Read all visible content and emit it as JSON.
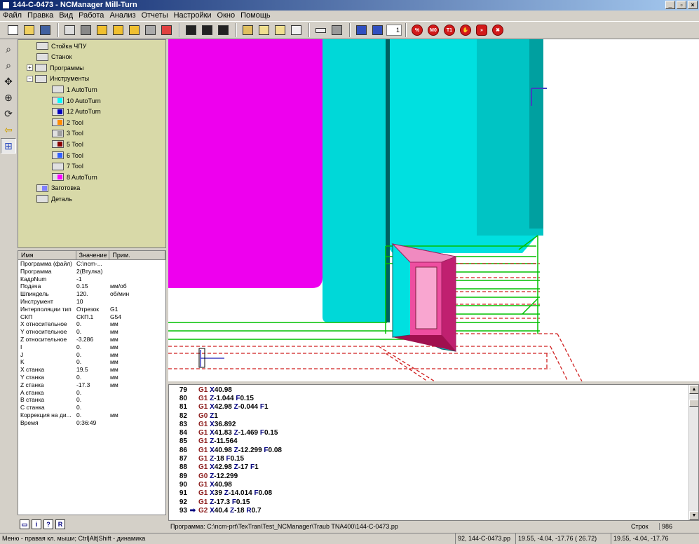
{
  "window": {
    "title": "144-C-0473 - NCManager Mill-Turn"
  },
  "menu": [
    "Файл",
    "Правка",
    "Вид",
    "Работа",
    "Анализ",
    "Отчеты",
    "Настройки",
    "Окно",
    "Помощь"
  ],
  "toolbar": {
    "spin_value": "1",
    "stop_labels": [
      "%",
      "M0",
      "T1",
      "",
      "»",
      ""
    ]
  },
  "tree": {
    "items": [
      {
        "label": "Стойка ЧПУ",
        "indent": 0,
        "swatch": ""
      },
      {
        "label": "Станок",
        "indent": 0,
        "swatch": ""
      },
      {
        "label": "Программы",
        "indent": 0,
        "swatch": "",
        "expand": "+"
      },
      {
        "label": "Инструменты",
        "indent": 0,
        "swatch": "",
        "expand": "-"
      },
      {
        "label": "1 AutoTurn",
        "indent": 1,
        "swatch": "#e0e0e0"
      },
      {
        "label": "10 AutoTurn",
        "indent": 1,
        "swatch": "#00ffff"
      },
      {
        "label": "12 AutoTurn",
        "indent": 1,
        "swatch": "#0000c0"
      },
      {
        "label": "2 Tool",
        "indent": 1,
        "swatch": "#ff8c00"
      },
      {
        "label": "3 Tool",
        "indent": 1,
        "swatch": "#a0a0a0"
      },
      {
        "label": "5 Tool",
        "indent": 1,
        "swatch": "#8b0000"
      },
      {
        "label": "6 Tool",
        "indent": 1,
        "swatch": "#3060ff"
      },
      {
        "label": "7 Tool",
        "indent": 1,
        "swatch": "#e0e0e0"
      },
      {
        "label": "8 AutoTurn",
        "indent": 1,
        "swatch": "#ff00ff"
      },
      {
        "label": "Заготовка",
        "indent": 0,
        "swatch": "#8080ff"
      },
      {
        "label": "Деталь",
        "indent": 0,
        "swatch": ""
      }
    ]
  },
  "props": {
    "headers": [
      "Имя",
      "Значение",
      "Прим."
    ],
    "rows": [
      [
        "Программа (файл)",
        "C:\\ncm-...",
        ""
      ],
      [
        "Программа",
        "2(Втулка)",
        ""
      ],
      [
        "КадрNum",
        "-1",
        ""
      ],
      [
        "Подача",
        "0.15",
        "мм/об"
      ],
      [
        "Шпиндель",
        "120.",
        "об/мин"
      ],
      [
        "Инструмент",
        "10",
        ""
      ],
      [
        "Интерполяции тип",
        "Отрезок",
        "G1"
      ],
      [
        "СКП",
        "СКП.1",
        "G54"
      ],
      [
        "X относительное",
        "0.",
        "мм"
      ],
      [
        "Y относительное",
        "0.",
        "мм"
      ],
      [
        "Z относительное",
        "-3.286",
        "мм"
      ],
      [
        "I",
        "0.",
        "мм"
      ],
      [
        "J",
        "0.",
        "мм"
      ],
      [
        "K",
        "0.",
        "мм"
      ],
      [
        "X станка",
        "19.5",
        "мм"
      ],
      [
        "Y станка",
        "0.",
        "мм"
      ],
      [
        "Z станка",
        "-17.3",
        "мм"
      ],
      [
        "A станка",
        "0.",
        ""
      ],
      [
        "B станка",
        "0.",
        ""
      ],
      [
        "C станка",
        "0.",
        ""
      ],
      [
        "Коррекция на ди...",
        "0.",
        "мм"
      ],
      [
        "Время",
        "0:36:49",
        ""
      ]
    ]
  },
  "code": {
    "lines": [
      {
        "n": "79",
        "parts": [
          [
            "g",
            "G1"
          ],
          [
            "t",
            " "
          ],
          [
            "f",
            "X"
          ],
          [
            "t",
            "40.98"
          ]
        ]
      },
      {
        "n": "80",
        "parts": [
          [
            "g",
            "G1"
          ],
          [
            "t",
            " "
          ],
          [
            "f",
            "Z"
          ],
          [
            "t",
            "-1.044 "
          ],
          [
            "f",
            "F"
          ],
          [
            "t",
            "0.15"
          ]
        ]
      },
      {
        "n": "81",
        "parts": [
          [
            "g",
            "G1"
          ],
          [
            "t",
            " "
          ],
          [
            "f",
            "X"
          ],
          [
            "t",
            "42.98 "
          ],
          [
            "f",
            "Z"
          ],
          [
            "t",
            "-0.044 "
          ],
          [
            "f",
            "F"
          ],
          [
            "t",
            "1"
          ]
        ]
      },
      {
        "n": "82",
        "parts": [
          [
            "g",
            "G0"
          ],
          [
            "t",
            " "
          ],
          [
            "f",
            "Z"
          ],
          [
            "t",
            "1"
          ]
        ]
      },
      {
        "n": "83",
        "parts": [
          [
            "g",
            "G1"
          ],
          [
            "t",
            " "
          ],
          [
            "f",
            "X"
          ],
          [
            "t",
            "36.892"
          ]
        ]
      },
      {
        "n": "84",
        "parts": [
          [
            "g",
            "G1"
          ],
          [
            "t",
            " "
          ],
          [
            "f",
            "X"
          ],
          [
            "t",
            "41.83 "
          ],
          [
            "f",
            "Z"
          ],
          [
            "t",
            "-1.469 "
          ],
          [
            "f",
            "F"
          ],
          [
            "t",
            "0.15"
          ]
        ]
      },
      {
        "n": "85",
        "parts": [
          [
            "g",
            "G1"
          ],
          [
            "t",
            " "
          ],
          [
            "f",
            "Z"
          ],
          [
            "t",
            "-11.564"
          ]
        ]
      },
      {
        "n": "86",
        "parts": [
          [
            "g",
            "G1"
          ],
          [
            "t",
            " "
          ],
          [
            "f",
            "X"
          ],
          [
            "t",
            "40.98 "
          ],
          [
            "f",
            "Z"
          ],
          [
            "t",
            "-12.299 "
          ],
          [
            "f",
            "F"
          ],
          [
            "t",
            "0.08"
          ]
        ]
      },
      {
        "n": "87",
        "parts": [
          [
            "g",
            "G1"
          ],
          [
            "t",
            " "
          ],
          [
            "f",
            "Z"
          ],
          [
            "t",
            "-18 "
          ],
          [
            "f",
            "F"
          ],
          [
            "t",
            "0.15"
          ]
        ]
      },
      {
        "n": "88",
        "parts": [
          [
            "g",
            "G1"
          ],
          [
            "t",
            " "
          ],
          [
            "f",
            "X"
          ],
          [
            "t",
            "42.98 "
          ],
          [
            "f",
            "Z"
          ],
          [
            "t",
            "-17 "
          ],
          [
            "f",
            "F"
          ],
          [
            "t",
            "1"
          ]
        ]
      },
      {
        "n": "89",
        "parts": [
          [
            "g",
            "G0"
          ],
          [
            "t",
            " "
          ],
          [
            "f",
            "Z"
          ],
          [
            "t",
            "-12.299"
          ]
        ]
      },
      {
        "n": "90",
        "parts": [
          [
            "g",
            "G1"
          ],
          [
            "t",
            " "
          ],
          [
            "f",
            "X"
          ],
          [
            "t",
            "40.98"
          ]
        ]
      },
      {
        "n": "91",
        "parts": [
          [
            "g",
            "G1"
          ],
          [
            "t",
            " "
          ],
          [
            "f",
            "X"
          ],
          [
            "t",
            "39 "
          ],
          [
            "f",
            "Z"
          ],
          [
            "t",
            "-14.014 "
          ],
          [
            "f",
            "F"
          ],
          [
            "t",
            "0.08"
          ]
        ]
      },
      {
        "n": "92",
        "parts": [
          [
            "g",
            "G1"
          ],
          [
            "t",
            " "
          ],
          [
            "f",
            "Z"
          ],
          [
            "t",
            "-17.3 "
          ],
          [
            "f",
            "F"
          ],
          [
            "t",
            "0.15"
          ]
        ]
      },
      {
        "n": "93",
        "current": true,
        "parts": [
          [
            "g",
            "G2"
          ],
          [
            "t",
            " "
          ],
          [
            "f",
            "X"
          ],
          [
            "t",
            "40.4 "
          ],
          [
            "f",
            "Z"
          ],
          [
            "t",
            "-18 "
          ],
          [
            "f",
            "R"
          ],
          [
            "t",
            "0.7"
          ]
        ]
      }
    ]
  },
  "pathbar": {
    "program": "Программа: C:\\ncm-prt\\TexTran\\Test_NCManager\\Traub TNA400\\144-C-0473.pp",
    "lines_label": "Строк",
    "lines_value": "986"
  },
  "status": {
    "hint": "Меню - правая кл. мыши; Ctrl|Alt|Shift - динамика",
    "frame": "92, 144-C-0473.pp",
    "coords1": "19.55, -4.04, -17.76 ( 26.72)",
    "coords2": "19.55, -4.04, -17.76"
  }
}
